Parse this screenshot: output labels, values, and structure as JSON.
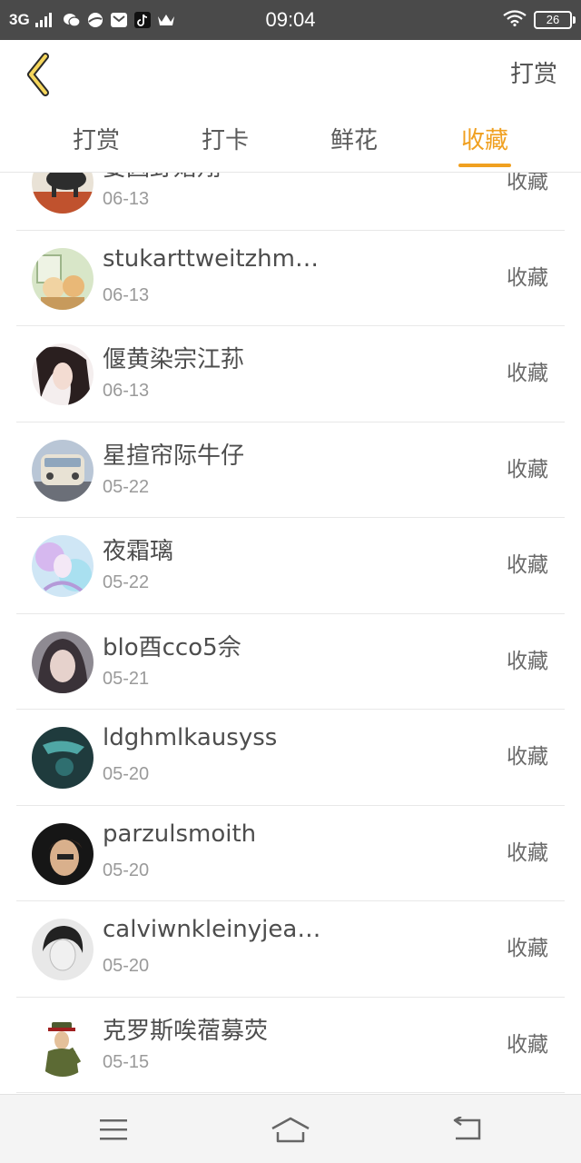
{
  "status_bar": {
    "network": "3G",
    "time": "09:04",
    "battery": "26",
    "icons": [
      "signal-icon",
      "wechat-icon",
      "browser-icon",
      "mail-icon",
      "tiktok-icon",
      "crown-icon",
      "wifi-icon",
      "battery-icon"
    ]
  },
  "header": {
    "back_icon": "chevron-left-icon",
    "action_label": "打赏",
    "accent_color": "#f0a020"
  },
  "tabs": [
    {
      "label": "打赏",
      "active": false
    },
    {
      "label": "打卡",
      "active": false
    },
    {
      "label": "鲜花",
      "active": false
    },
    {
      "label": "收藏",
      "active": true
    }
  ],
  "list": {
    "items": [
      {
        "name": "要因野婚翔",
        "date": "06-13",
        "status": "收藏"
      },
      {
        "name": "stukarttweitzhm…",
        "date": "06-13",
        "status": "收藏"
      },
      {
        "name": "偃黄染宗江荪",
        "date": "06-13",
        "status": "收藏"
      },
      {
        "name": "星揎帘际牛仔",
        "date": "05-22",
        "status": "收藏"
      },
      {
        "name": "夜霜璃",
        "date": "05-22",
        "status": "收藏"
      },
      {
        "name": "blo酉cco5佘",
        "date": "05-21",
        "status": "收藏"
      },
      {
        "name": "ldghmlkausyss",
        "date": "05-20",
        "status": "收藏"
      },
      {
        "name": "parzulsmoith",
        "date": "05-20",
        "status": "收藏"
      },
      {
        "name": "calviwnkleinyjea…",
        "date": "05-20",
        "status": "收藏"
      },
      {
        "name": "克罗斯唉蓿募荧",
        "date": "05-15",
        "status": "收藏"
      }
    ]
  },
  "bottom_nav": {
    "icons": [
      "menu-icon",
      "home-icon",
      "back-icon"
    ]
  }
}
